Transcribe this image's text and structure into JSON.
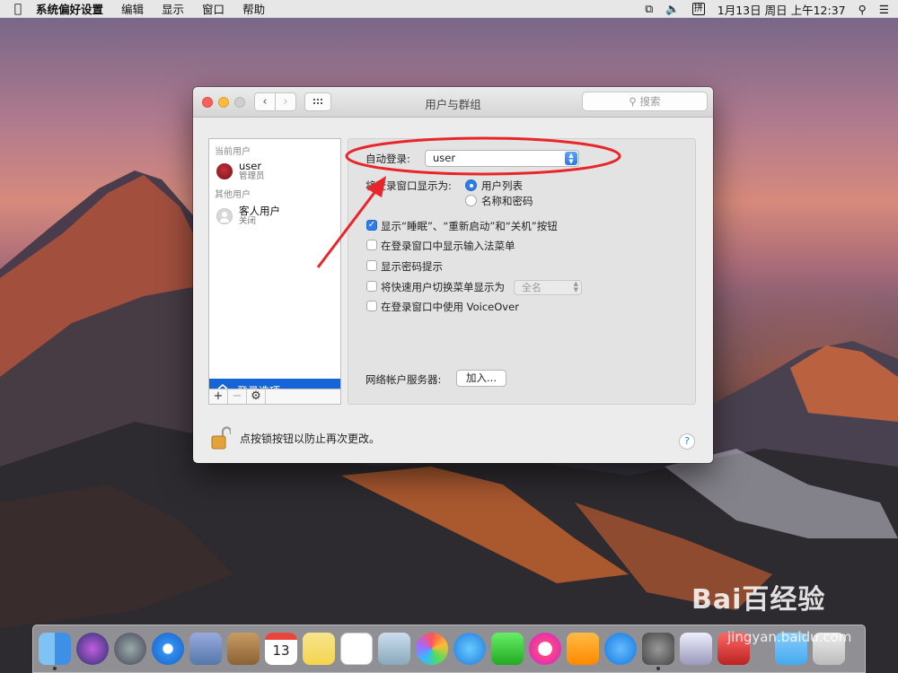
{
  "menubar": {
    "app": "系统偏好设置",
    "items": [
      "编辑",
      "显示",
      "窗口",
      "帮助"
    ],
    "input_icon_label": "拼",
    "datetime": "1月13日 周日 上午12:37"
  },
  "window": {
    "title": "用户与群组",
    "search_placeholder": "搜索"
  },
  "userlist": {
    "current_section": "当前用户",
    "current_user": {
      "name": "user",
      "role": "管理员"
    },
    "other_section": "其他用户",
    "guest_user": {
      "name": "客人用户",
      "status": "关闭"
    },
    "login_options": "登录选项",
    "toolbar": {
      "add": "+",
      "remove": "−"
    }
  },
  "login_pane": {
    "auto_login_label": "自动登录:",
    "auto_login_value": "user",
    "display_label": "将登录窗口显示为:",
    "radio_options": [
      {
        "label": "用户列表",
        "selected": true
      },
      {
        "label": "名称和密码",
        "selected": false
      }
    ],
    "checkboxes": [
      {
        "label": "显示“睡眠”、“重新启动”和“关机”按钮",
        "checked": true
      },
      {
        "label": "在登录窗口中显示输入法菜单",
        "checked": false
      },
      {
        "label": "显示密码提示",
        "checked": false
      },
      {
        "label": "将快速用户切换菜单显示为",
        "checked": false
      },
      {
        "label": "在登录窗口中使用 VoiceOver",
        "checked": false
      }
    ],
    "fast_switch_value": "全名",
    "network_server_label": "网络帐户服务器:",
    "join_button": "加入..."
  },
  "footer": {
    "lock_text": "点按锁按钮以防止再次更改。",
    "help": "?"
  },
  "dock": {
    "calendar_day": "13",
    "apps": [
      "finder-icon",
      "siri-icon",
      "launchpad-icon",
      "safari-icon",
      "mail-bird-icon",
      "contacts-icon",
      "calendar-icon",
      "notes-icon",
      "reminders-icon",
      "preview-icon",
      "photos-icon",
      "messages-icon",
      "facetime-icon",
      "itunes-icon",
      "ibooks-icon",
      "app-store-icon",
      "system-preferences-icon",
      "trash-icon"
    ]
  },
  "watermark": {
    "brand": "Bai百经验",
    "url": "jingyan.baidu.com"
  },
  "colors": {
    "accent": "#2f7be9",
    "selection": "#1665d8",
    "annotation": "#e8262a"
  }
}
